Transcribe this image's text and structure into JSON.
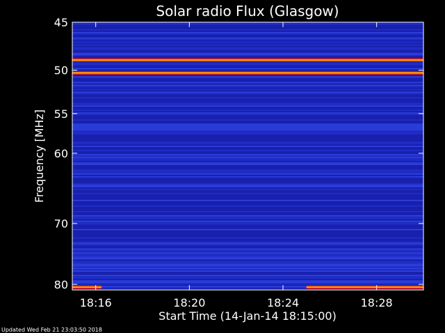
{
  "chart_data": {
    "type": "heatmap",
    "title": "Solar radio Flux (Glasgow)",
    "xlabel": "Start Time (14-Jan-14 18:15:00)",
    "ylabel": "Frequency [MHz]",
    "xlim": [
      "18:15:00",
      "18:30:00"
    ],
    "ylim": [
      45,
      81
    ],
    "y_scale": "log",
    "x_ticks": [
      "18:16",
      "18:20",
      "18:24",
      "18:28"
    ],
    "y_ticks": [
      45,
      50,
      55,
      60,
      70,
      80
    ],
    "colors": {
      "background": "#1a20b8",
      "band_bright": "#ff9a10",
      "band_red": "#e01010",
      "band_white": "#fff6c0",
      "frame": "#ffffff"
    },
    "bands": [
      {
        "freq_mhz": 48.9,
        "level": "high"
      },
      {
        "freq_mhz": 50.3,
        "level": "high"
      },
      {
        "freq_mhz": 80.5,
        "level": "high",
        "start": "18:25",
        "end": "18:30"
      },
      {
        "freq_mhz": 80.5,
        "level": "high",
        "start": "18:15:00",
        "end": "18:16:15"
      }
    ]
  },
  "footer": {
    "updated": "Updated Wed Feb 21 23:03:50 2018"
  }
}
